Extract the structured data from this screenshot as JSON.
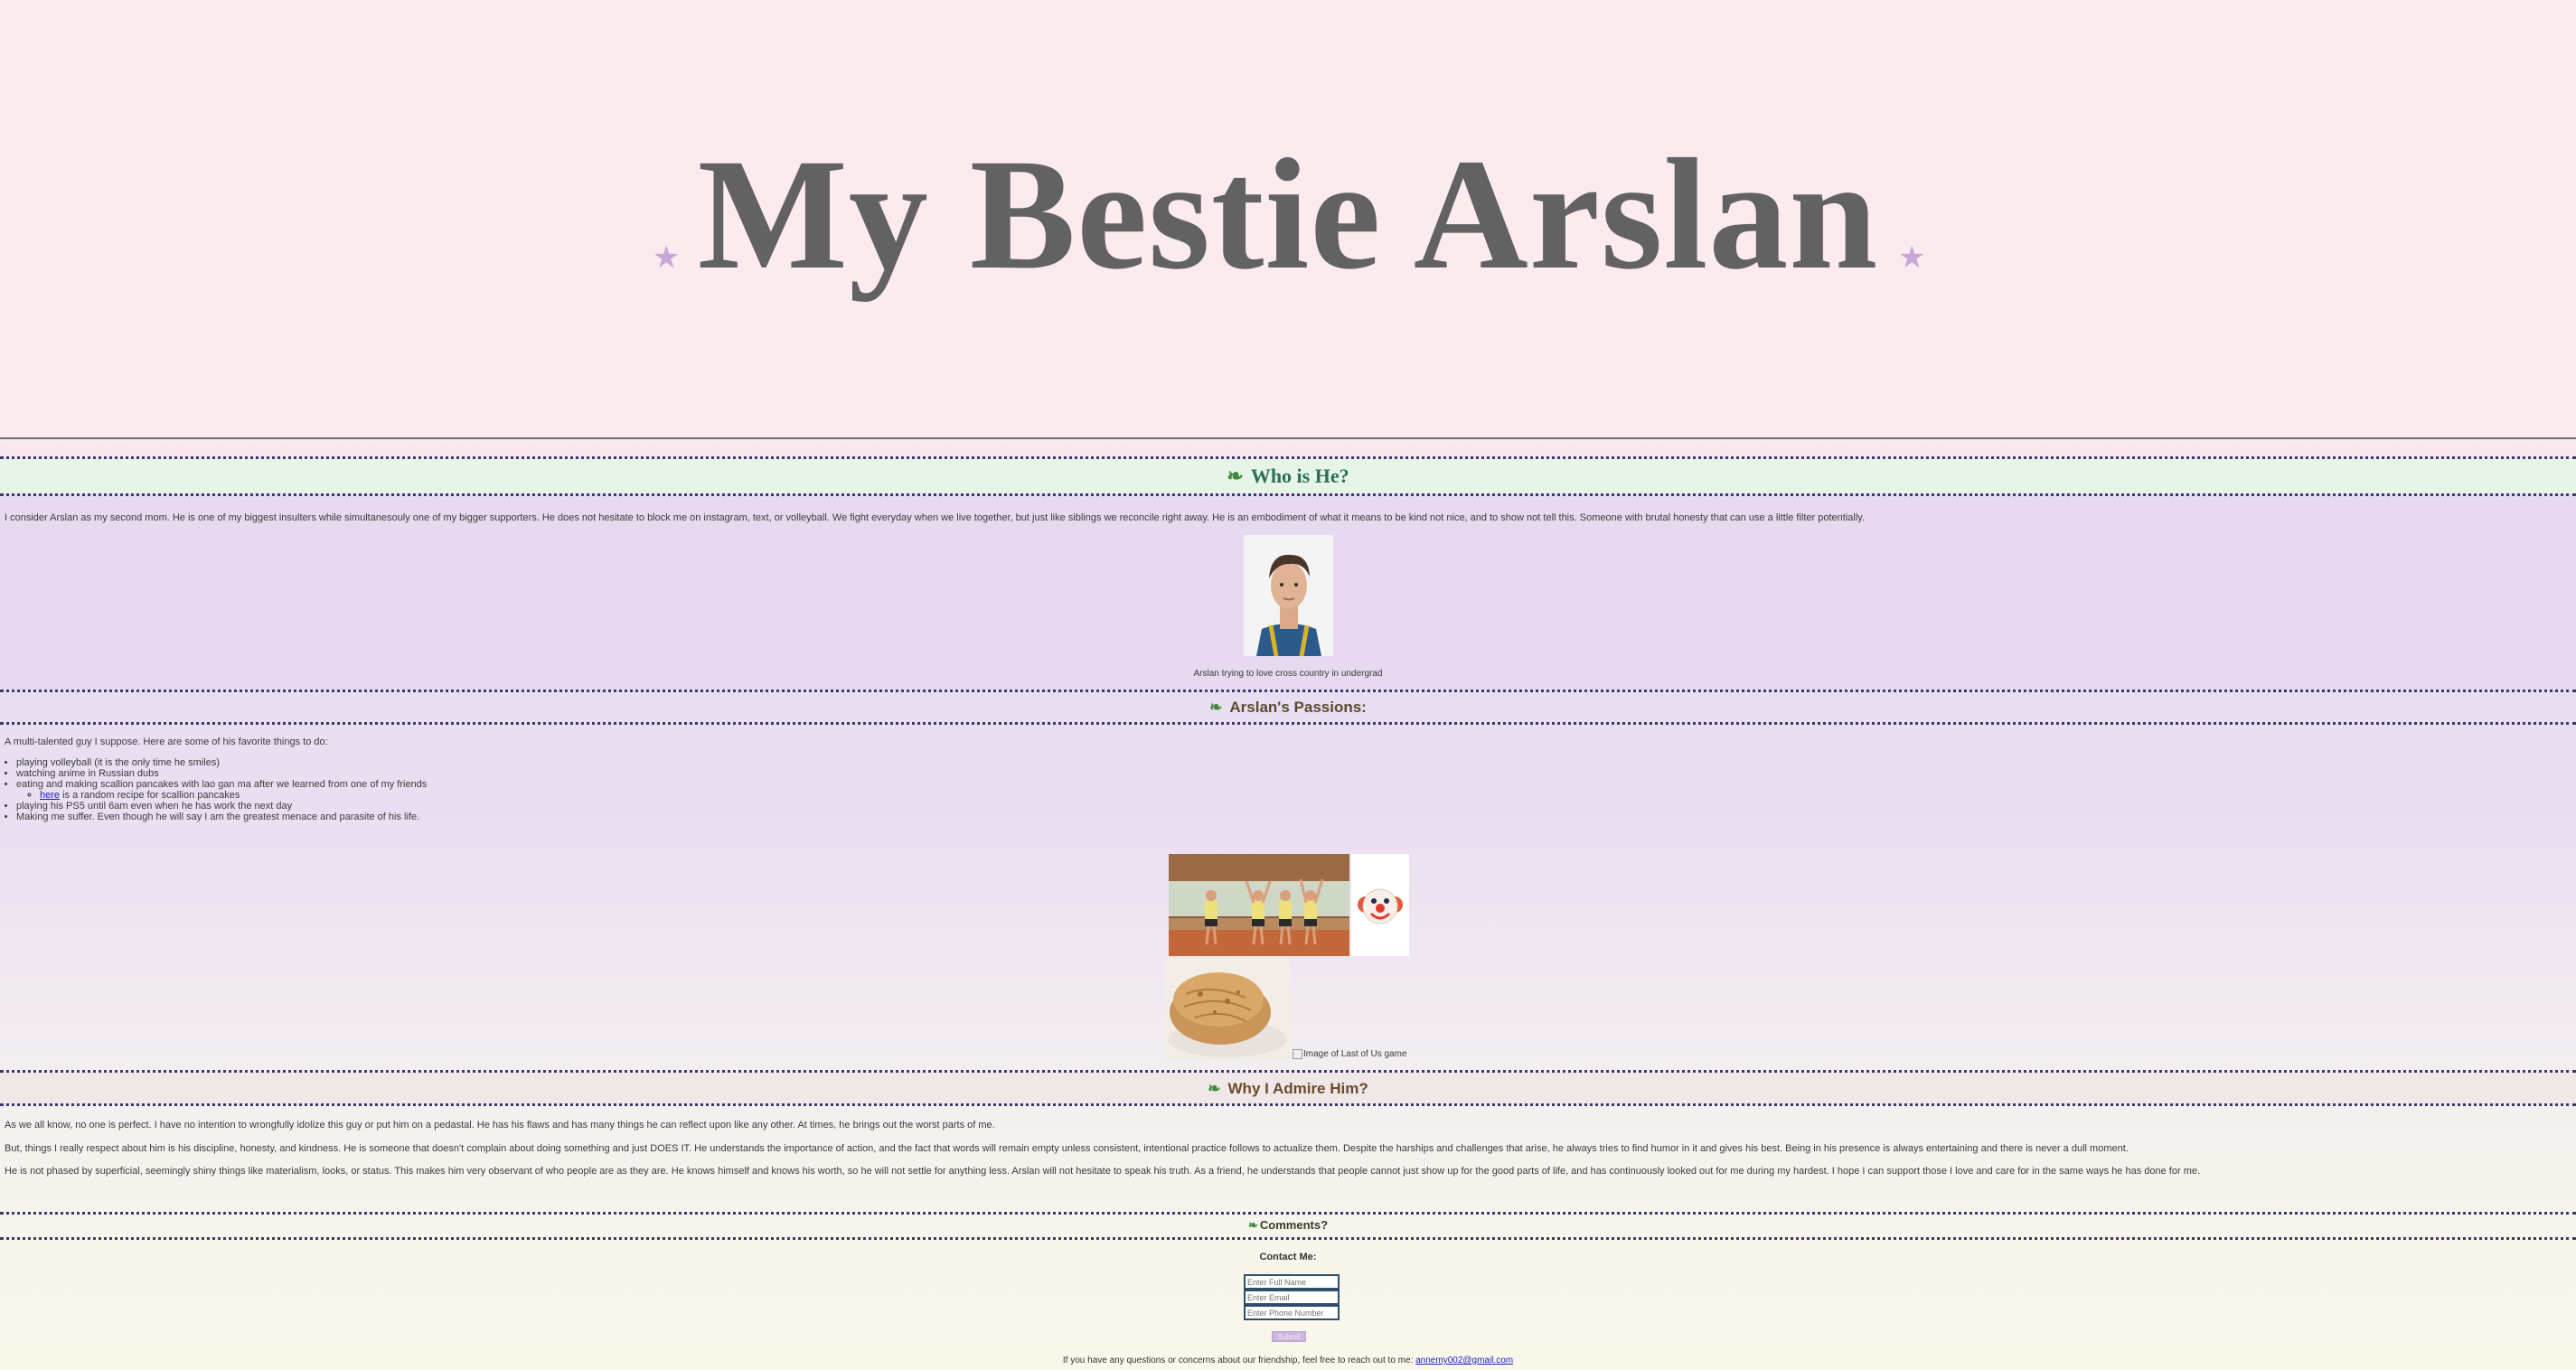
{
  "header": {
    "title": "My Bestie Arslan"
  },
  "who": {
    "title": "Who is He?",
    "paragraph": "I consider Arslan as my second mom. He is one of my biggest insulters while simultanesouly one of my bigger supporters. He does not hesitate to block me on instagram, text, or volleyball. We fight everyday when we live together, but just like siblings we reconcile right away. He is an embodiment of what it means to be kind not nice, and to show not tell this. Someone with brutal honesty that can use a little filter potentially.",
    "caption": "Arslan trying to love cross country in undergrad"
  },
  "passions": {
    "title": "Arslan's Passions:",
    "intro": "A multi-talented guy I suppose. Here are some of his favorite things to do:",
    "items": [
      "playing volleyball (it is the only time he smiles)",
      "watching anime in Russian dubs",
      "eating and making scallion pancakes with lao gan ma after we learned from one of my friends",
      "playing his PS5 until 6am even when he has work the next day",
      "Making me suffer. Even though he will say I am the greatest menace and parasite of his life."
    ],
    "sub_link": "here",
    "sub_text": " is a random recipe for scallion pancakes",
    "broken_image_alt": "Image of Last of Us game"
  },
  "admire": {
    "title": "Why I Admire Him?",
    "p1": "As we all know, no one is perfect. I have no intention to wrongfully idolize this guy or put him on a pedastal. He has his flaws and has many things he can reflect upon like any other. At times, he brings out the worst parts of me.",
    "p2": "But, things I really respect about him is his discipline, honesty, and kindness. He is someone that doesn't complain about doing something and just DOES IT. He understands the importance of action, and the fact that words will remain empty unless consistent, intentional practice follows to actualize them. Despite the harships and challenges that arise, he always tries to find humor in it and gives his best. Being in his presence is always entertaining and there is never a dull moment.",
    "p3": "He is not phased by superficial, seemingly shiny things like materialism, looks, or status. This makes him very observant of who people are as they are. He knows himself and knows his worth, so he will not settle for anything less. Arslan will not hesitate to speak his truth. As a friend, he understands that people cannot just show up for the good parts of life, and has continuously looked out for me during my hardest. I hope I can support those I love and care for in the same ways he has done for me."
  },
  "comments": {
    "title": "Comments?",
    "contact_label": "Contact Me:",
    "name_placeholder": "Enter Full Name",
    "email_placeholder": "Enter Email",
    "phone_placeholder": "Enter Phone Number",
    "submit_label": "Submit"
  },
  "footer": {
    "text": "If you have any questions or concerns about our friendship, feel free to reach out to me: ",
    "email": "annemy002@gmail.com"
  },
  "colors": {
    "who_band": "#e6f5e8",
    "who_title": "#2e6e5a",
    "passions_title": "#5a4a2e",
    "admire_band": "#f0e8e8",
    "admire_title": "#6a4a2a",
    "accent_star": "#c7a6d8"
  }
}
